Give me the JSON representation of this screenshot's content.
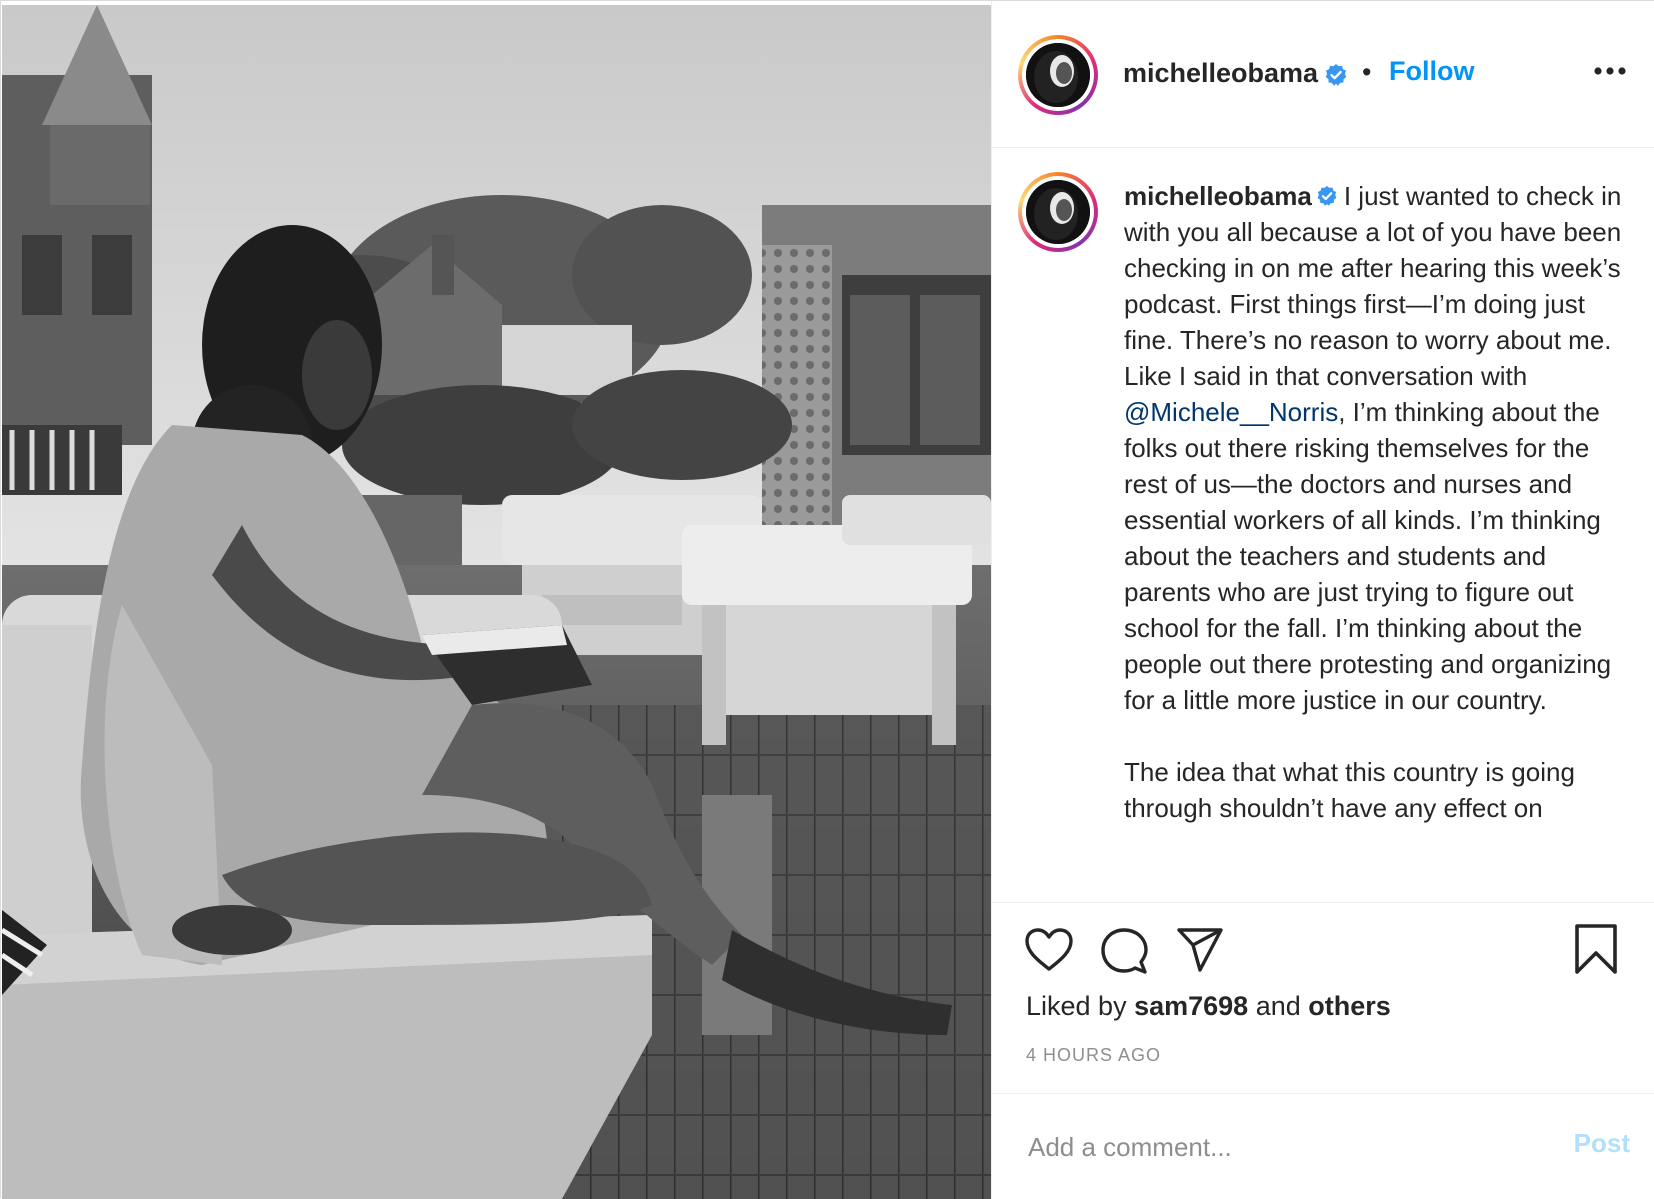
{
  "header": {
    "username": "michelleobama",
    "separator": "•",
    "follow_label": "Follow",
    "more_icon": "more-horizontal-icon"
  },
  "caption": {
    "username": "michelleobama",
    "part1": "I just wanted to check in with you all because a lot of you have been checking in on me after hearing this week’s podcast. First things first—I’m doing just fine. There’s no reason to worry about me. Like I said in that conversation with ",
    "mention": "@Michele__Norris",
    "part2": ", I’m thinking about the folks out there risking themselves for the rest of us—the doctors and nurses and essential workers of all kinds. I’m thinking about the teachers and students and parents who are just trying to figure out school for the fall. I’m thinking about the people out there protesting and organizing for a little more justice in our country.",
    "part3": "The idea that what this country is going through shouldn’t have any effect on"
  },
  "actions": {
    "icons": [
      "heart-icon",
      "comment-icon",
      "share-icon",
      "bookmark-icon"
    ],
    "liked_by_prefix": "Liked by",
    "liked_by_user": "sam7698",
    "liked_by_and": "and",
    "liked_by_others": "others",
    "timestamp": "4 HOURS AGO"
  },
  "comment": {
    "placeholder": "Add a comment...",
    "post_label": "Post"
  },
  "colors": {
    "link_blue": "#0095f6",
    "mention_blue": "#00376b",
    "verified_blue": "#3897f0",
    "post_disabled": "#b2dffc",
    "muted": "#8e8e8e",
    "text": "#262626"
  }
}
